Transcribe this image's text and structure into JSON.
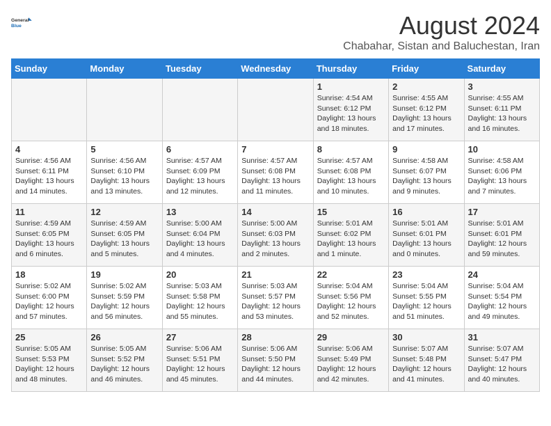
{
  "header": {
    "logo_line1": "General",
    "logo_line2": "Blue",
    "main_title": "August 2024",
    "subtitle": "Chabahar, Sistan and Baluchestan, Iran"
  },
  "days_of_week": [
    "Sunday",
    "Monday",
    "Tuesday",
    "Wednesday",
    "Thursday",
    "Friday",
    "Saturday"
  ],
  "weeks": [
    {
      "cells": [
        {
          "day": "",
          "info": ""
        },
        {
          "day": "",
          "info": ""
        },
        {
          "day": "",
          "info": ""
        },
        {
          "day": "",
          "info": ""
        },
        {
          "day": "1",
          "info": "Sunrise: 4:54 AM\nSunset: 6:12 PM\nDaylight: 13 hours\nand 18 minutes."
        },
        {
          "day": "2",
          "info": "Sunrise: 4:55 AM\nSunset: 6:12 PM\nDaylight: 13 hours\nand 17 minutes."
        },
        {
          "day": "3",
          "info": "Sunrise: 4:55 AM\nSunset: 6:11 PM\nDaylight: 13 hours\nand 16 minutes."
        }
      ]
    },
    {
      "cells": [
        {
          "day": "4",
          "info": "Sunrise: 4:56 AM\nSunset: 6:11 PM\nDaylight: 13 hours\nand 14 minutes."
        },
        {
          "day": "5",
          "info": "Sunrise: 4:56 AM\nSunset: 6:10 PM\nDaylight: 13 hours\nand 13 minutes."
        },
        {
          "day": "6",
          "info": "Sunrise: 4:57 AM\nSunset: 6:09 PM\nDaylight: 13 hours\nand 12 minutes."
        },
        {
          "day": "7",
          "info": "Sunrise: 4:57 AM\nSunset: 6:08 PM\nDaylight: 13 hours\nand 11 minutes."
        },
        {
          "day": "8",
          "info": "Sunrise: 4:57 AM\nSunset: 6:08 PM\nDaylight: 13 hours\nand 10 minutes."
        },
        {
          "day": "9",
          "info": "Sunrise: 4:58 AM\nSunset: 6:07 PM\nDaylight: 13 hours\nand 9 minutes."
        },
        {
          "day": "10",
          "info": "Sunrise: 4:58 AM\nSunset: 6:06 PM\nDaylight: 13 hours\nand 7 minutes."
        }
      ]
    },
    {
      "cells": [
        {
          "day": "11",
          "info": "Sunrise: 4:59 AM\nSunset: 6:05 PM\nDaylight: 13 hours\nand 6 minutes."
        },
        {
          "day": "12",
          "info": "Sunrise: 4:59 AM\nSunset: 6:05 PM\nDaylight: 13 hours\nand 5 minutes."
        },
        {
          "day": "13",
          "info": "Sunrise: 5:00 AM\nSunset: 6:04 PM\nDaylight: 13 hours\nand 4 minutes."
        },
        {
          "day": "14",
          "info": "Sunrise: 5:00 AM\nSunset: 6:03 PM\nDaylight: 13 hours\nand 2 minutes."
        },
        {
          "day": "15",
          "info": "Sunrise: 5:01 AM\nSunset: 6:02 PM\nDaylight: 13 hours\nand 1 minute."
        },
        {
          "day": "16",
          "info": "Sunrise: 5:01 AM\nSunset: 6:01 PM\nDaylight: 13 hours\nand 0 minutes."
        },
        {
          "day": "17",
          "info": "Sunrise: 5:01 AM\nSunset: 6:01 PM\nDaylight: 12 hours\nand 59 minutes."
        }
      ]
    },
    {
      "cells": [
        {
          "day": "18",
          "info": "Sunrise: 5:02 AM\nSunset: 6:00 PM\nDaylight: 12 hours\nand 57 minutes."
        },
        {
          "day": "19",
          "info": "Sunrise: 5:02 AM\nSunset: 5:59 PM\nDaylight: 12 hours\nand 56 minutes."
        },
        {
          "day": "20",
          "info": "Sunrise: 5:03 AM\nSunset: 5:58 PM\nDaylight: 12 hours\nand 55 minutes."
        },
        {
          "day": "21",
          "info": "Sunrise: 5:03 AM\nSunset: 5:57 PM\nDaylight: 12 hours\nand 53 minutes."
        },
        {
          "day": "22",
          "info": "Sunrise: 5:04 AM\nSunset: 5:56 PM\nDaylight: 12 hours\nand 52 minutes."
        },
        {
          "day": "23",
          "info": "Sunrise: 5:04 AM\nSunset: 5:55 PM\nDaylight: 12 hours\nand 51 minutes."
        },
        {
          "day": "24",
          "info": "Sunrise: 5:04 AM\nSunset: 5:54 PM\nDaylight: 12 hours\nand 49 minutes."
        }
      ]
    },
    {
      "cells": [
        {
          "day": "25",
          "info": "Sunrise: 5:05 AM\nSunset: 5:53 PM\nDaylight: 12 hours\nand 48 minutes."
        },
        {
          "day": "26",
          "info": "Sunrise: 5:05 AM\nSunset: 5:52 PM\nDaylight: 12 hours\nand 46 minutes."
        },
        {
          "day": "27",
          "info": "Sunrise: 5:06 AM\nSunset: 5:51 PM\nDaylight: 12 hours\nand 45 minutes."
        },
        {
          "day": "28",
          "info": "Sunrise: 5:06 AM\nSunset: 5:50 PM\nDaylight: 12 hours\nand 44 minutes."
        },
        {
          "day": "29",
          "info": "Sunrise: 5:06 AM\nSunset: 5:49 PM\nDaylight: 12 hours\nand 42 minutes."
        },
        {
          "day": "30",
          "info": "Sunrise: 5:07 AM\nSunset: 5:48 PM\nDaylight: 12 hours\nand 41 minutes."
        },
        {
          "day": "31",
          "info": "Sunrise: 5:07 AM\nSunset: 5:47 PM\nDaylight: 12 hours\nand 40 minutes."
        }
      ]
    }
  ]
}
